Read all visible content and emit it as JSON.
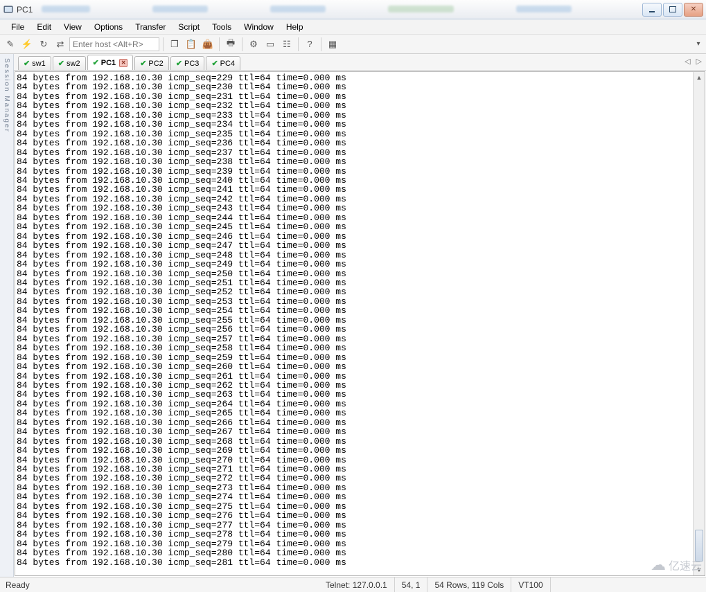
{
  "window": {
    "title": "PC1"
  },
  "menu": {
    "items": [
      "File",
      "Edit",
      "View",
      "Options",
      "Transfer",
      "Script",
      "Tools",
      "Window",
      "Help"
    ]
  },
  "toolbar": {
    "host_placeholder": "Enter host <Alt+R>"
  },
  "sidepanel": {
    "label": "Session Manager"
  },
  "tabs": {
    "items": [
      {
        "label": "sw1",
        "active": false,
        "closeable": false
      },
      {
        "label": "sw2",
        "active": false,
        "closeable": false
      },
      {
        "label": "PC1",
        "active": true,
        "closeable": true
      },
      {
        "label": "PC2",
        "active": false,
        "closeable": false
      },
      {
        "label": "PC3",
        "active": false,
        "closeable": false
      },
      {
        "label": "PC4",
        "active": false,
        "closeable": false
      }
    ]
  },
  "terminal": {
    "ip": "192.168.10.30",
    "bytes": 84,
    "ttl": 64,
    "time": "0.000",
    "unit": "ms",
    "seq_start": 229,
    "seq_end": 281
  },
  "status": {
    "ready": "Ready",
    "conn": "Telnet: 127.0.0.1",
    "cursor": "54,   1",
    "size": "54 Rows, 119 Cols",
    "term": "VT100"
  },
  "watermark": "亿速云"
}
